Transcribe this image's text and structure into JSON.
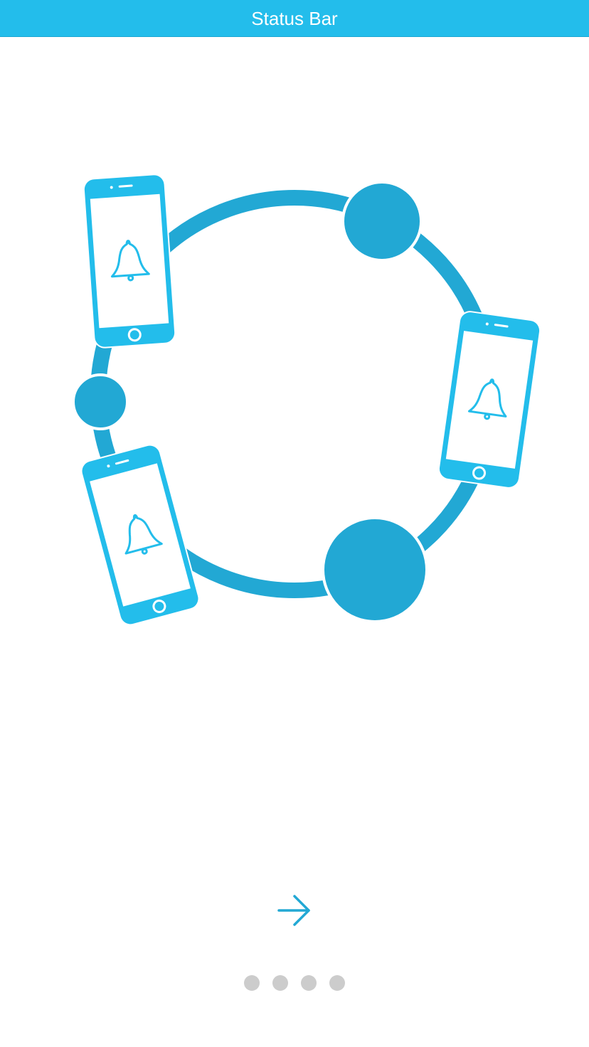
{
  "status_bar": {
    "title": "Status Bar"
  },
  "colors": {
    "brand_blue": "#23BDEB",
    "ring_blue": "#22A8D4",
    "dot_inactive": "#cccccc",
    "background": "#ffffff"
  },
  "illustration": {
    "icons": [
      "ring-icon",
      "phone-icon",
      "bell-icon",
      "node-circle"
    ],
    "phone_count": 3
  },
  "navigation": {
    "next_icon": "arrow-right-icon"
  },
  "pagination": {
    "total_pages": 4,
    "current_page": null
  }
}
